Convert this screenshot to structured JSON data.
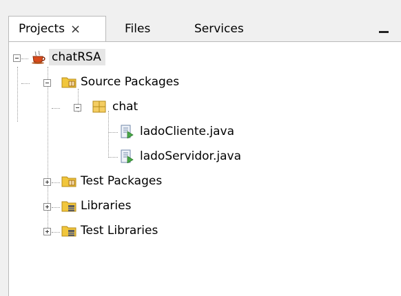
{
  "tabs": {
    "projects": "Projects",
    "projects_close": "×",
    "files": "Files",
    "services": "Services"
  },
  "tree": {
    "root": "chatRSA",
    "source_packages": "Source Packages",
    "chat_package": "chat",
    "file1": "ladoCliente.java",
    "file2": "ladoServidor.java",
    "test_packages": "Test Packages",
    "libraries": "Libraries",
    "test_libraries": "Test Libraries"
  },
  "icons": {
    "project": "java-cup-icon",
    "source_packages": "source-folder-icon",
    "package": "package-icon",
    "java_file": "java-class-file-icon",
    "libraries": "library-folder-icon"
  },
  "colors": {
    "selection_bg": "#e6e6e6",
    "folder_yellow": "#f1c63c",
    "java_green": "#48a848"
  }
}
